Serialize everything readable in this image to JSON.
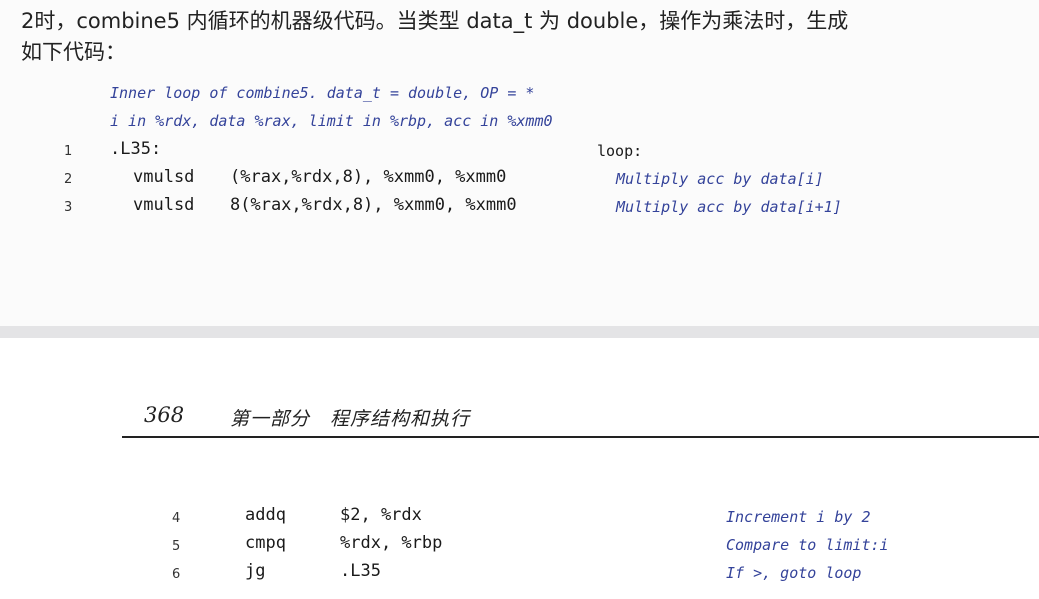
{
  "intro": {
    "line1": "2时，combine5 内循环的机器级代码。当类型 data_t 为 double，操作为乘法时，生成",
    "line2": "如下代码："
  },
  "listing1": {
    "comment1": "Inner loop of combine5.  data_t = double, OP = *",
    "comment2": "i in %rdx, data %rax, limit in %rbp, acc in %xmm0",
    "rows": [
      {
        "num": "1",
        "label": ".L35:",
        "note": "loop:"
      },
      {
        "num": "2",
        "instr": "vmulsd",
        "operands": "(%rax,%rdx,8), %xmm0, %xmm0",
        "note": "Multiply acc by data[i]"
      },
      {
        "num": "3",
        "instr": "vmulsd",
        "operands": "8(%rax,%rdx,8), %xmm0, %xmm0",
        "note": "Multiply acc by data[i+1]"
      }
    ]
  },
  "page_header": {
    "page_number": "368",
    "title": "第一部分　程序结构和执行"
  },
  "listing2": {
    "rows": [
      {
        "num": "4",
        "instr": "addq",
        "operands": "$2, %rdx",
        "note": "Increment i by 2"
      },
      {
        "num": "5",
        "instr": "cmpq",
        "operands": "%rdx, %rbp",
        "note": "Compare to limit:i"
      },
      {
        "num": "6",
        "instr": "jg",
        "operands": ".L35",
        "note": "If >, goto loop"
      }
    ]
  }
}
